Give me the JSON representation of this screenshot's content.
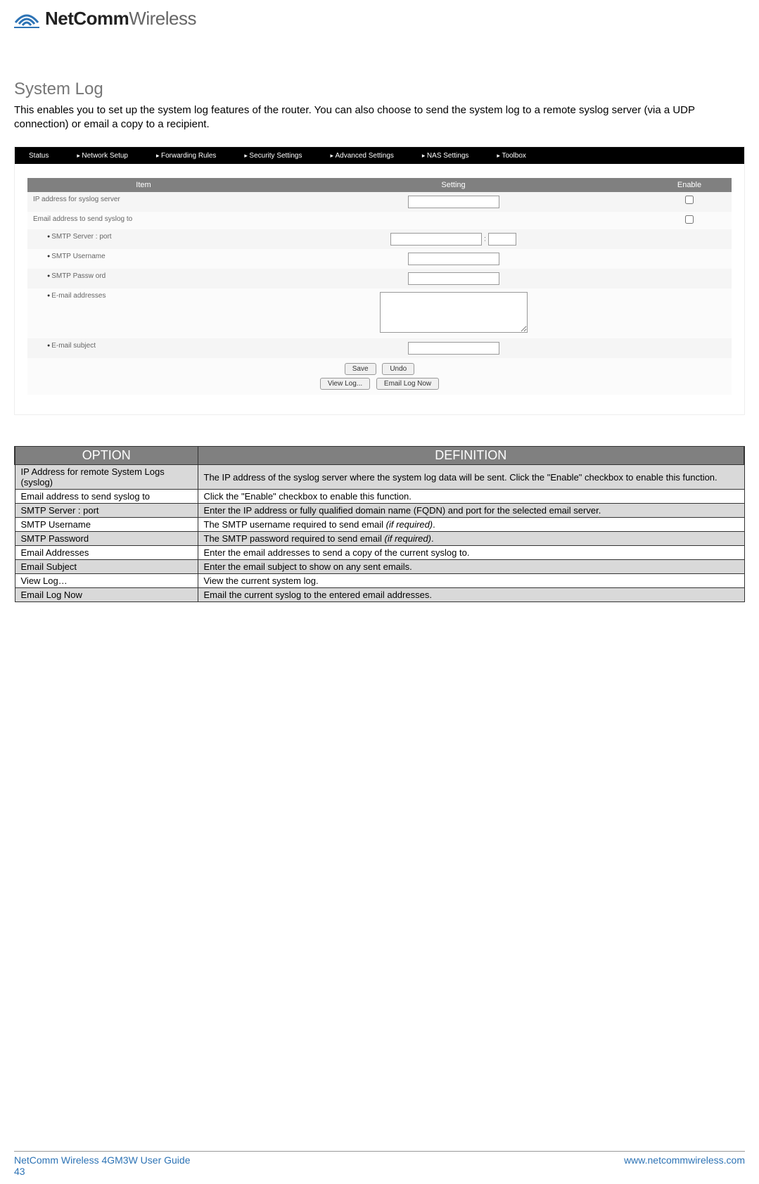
{
  "logo": {
    "bold": "NetComm",
    "light": "Wireless"
  },
  "section": {
    "title": "System Log",
    "intro": "This enables you to set up the system log features of the router. You can also choose to send the system log to a remote syslog server (via a UDP connection) or email a copy to a recipient."
  },
  "nav": {
    "status": "Status",
    "network": "Network Setup",
    "forwarding": "Forwarding Rules",
    "security": "Security Settings",
    "advanced": "Advanced Settings",
    "nas": "NAS Settings",
    "toolbox": "Toolbox"
  },
  "cfg": {
    "headers": {
      "item": "Item",
      "setting": "Setting",
      "enable": "Enable"
    },
    "rows": {
      "ip": "IP address for syslog server",
      "email_to": "Email address to send syslog to",
      "smtp_server": "SMTP Server : port",
      "smtp_user": "SMTP Username",
      "smtp_pass": "SMTP Passw ord",
      "email_addrs": "E-mail addresses",
      "email_subj": "E-mail subject"
    },
    "port_sep": ":",
    "buttons": {
      "save": "Save",
      "undo": "Undo",
      "viewlog": "View Log...",
      "emailnow": "Email Log Now"
    }
  },
  "def": {
    "headers": {
      "option": "OPTION",
      "definition": "DEFINITION"
    },
    "rows": [
      {
        "opt": "IP Address for remote System Logs (syslog)",
        "def": "The IP address of the syslog server where the system log data will be sent. Click the \"Enable\" checkbox to enable this function."
      },
      {
        "opt": "Email address to send syslog to",
        "def": "Click the \"Enable\" checkbox to enable this function."
      },
      {
        "opt": "SMTP Server : port",
        "def": "Enter the IP address or fully qualified domain name (FQDN) and port for the selected email server."
      },
      {
        "opt": "SMTP Username",
        "def_prefix": "The SMTP username required to send email ",
        "def_em": "(if required)",
        "def_suffix": "."
      },
      {
        "opt": "SMTP Password",
        "def_prefix": "The SMTP password required to send email ",
        "def_em": "(if required)",
        "def_suffix": "."
      },
      {
        "opt": "Email Addresses",
        "def": "Enter the email addresses to send a copy of the current syslog to."
      },
      {
        "opt": "Email Subject",
        "def": "Enter the email subject to show on any sent emails."
      },
      {
        "opt": "View Log…",
        "def": "View the current system log."
      },
      {
        "opt": "Email Log Now",
        "def": "Email the current syslog to the entered email addresses."
      }
    ]
  },
  "footer": {
    "left": "NetComm Wireless 4GM3W User Guide",
    "right": "www.netcommwireless.com",
    "page": "43"
  }
}
